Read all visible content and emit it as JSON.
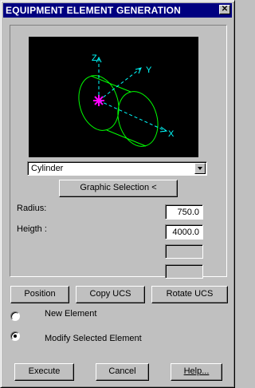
{
  "window": {
    "title": "EQUIPMENT ELEMENT GENERATION",
    "close_glyph": "✕"
  },
  "preview": {
    "axis_labels": {
      "z": "Z",
      "y": "Y",
      "x": "X"
    },
    "colors": {
      "background": "#000000",
      "cylinder": "#00ff00",
      "axes": "#00ffff",
      "origin": "#ff00ff"
    }
  },
  "shape_select": {
    "value": "Cylinder"
  },
  "graphic_selection_label": "Graphic Selection <",
  "params": {
    "radius_label": "Radius:",
    "radius_value": "750.0",
    "height_label": "Heigth :",
    "height_value": "4000.0",
    "empty1_value": "",
    "empty2_value": ""
  },
  "tools": {
    "position": "Position",
    "copy_ucs": "Copy UCS",
    "rotate_ucs": "Rotate UCS"
  },
  "mode": {
    "new_element": "New Element",
    "modify_selected": "Modify Selected Element",
    "selected": "modify_selected"
  },
  "footer": {
    "execute": "Execute",
    "cancel": "Cancel",
    "help": "Help..."
  }
}
